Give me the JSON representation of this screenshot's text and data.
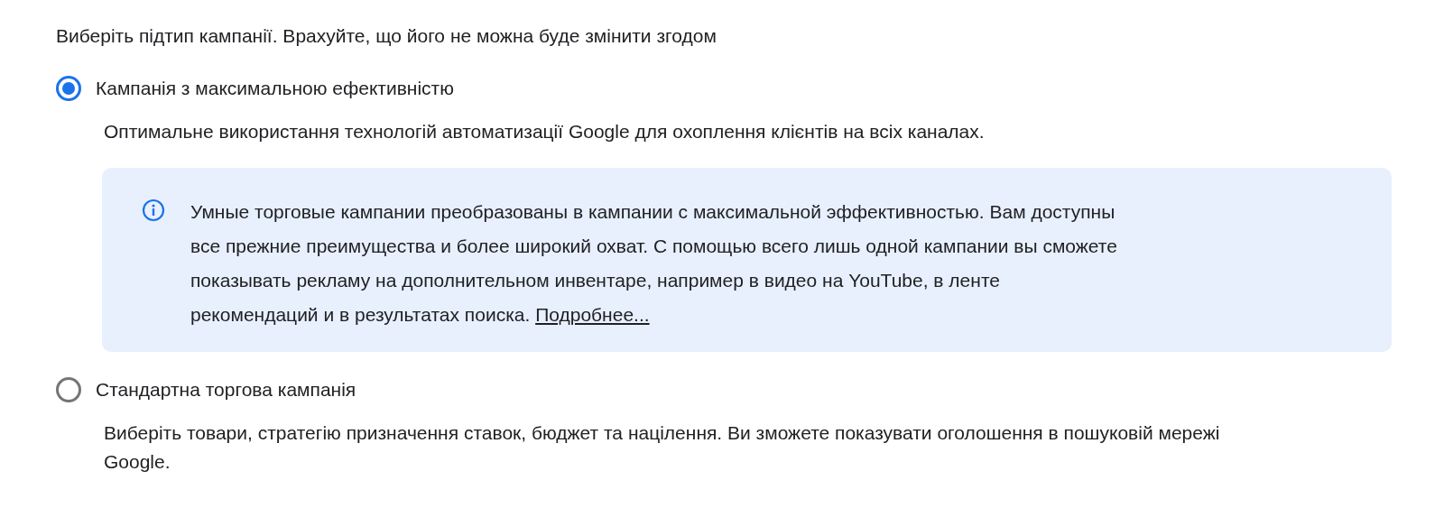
{
  "heading": "Виберіть підтип кампанії. Врахуйте, що його не можна буде змінити згодом",
  "options": [
    {
      "label": "Кампанія з максимальною ефективністю",
      "selected": true,
      "description": "Оптимальне використання технологій автоматизації Google для охоплення клієнтів на всіх каналах.",
      "notice": {
        "text": "Умные торговые кампании преобразованы в кампании с максимальной эффективностью. Вам доступны все прежние преимущества и более широкий охват. С помощью всего лишь одной кампании вы сможете показывать рекламу на дополнительном инвентаре, например в видео на YouTube, в ленте рекомендаций и в результатах поиска.",
        "link": "Подробнее..."
      }
    },
    {
      "label": "Стандартна торгова кампанія",
      "selected": false,
      "description": "Виберіть товари, стратегію призначення ставок, бюджет та націлення. Ви зможете показувати оголошення в пошуковій мережі Google."
    }
  ]
}
